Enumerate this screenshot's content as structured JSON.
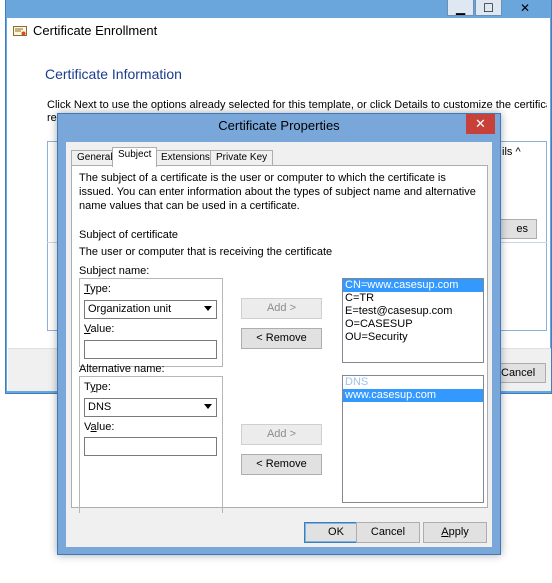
{
  "caption_buttons": {
    "minimize": "▁",
    "maximize": "☐",
    "close": "✕"
  },
  "wizard": {
    "title": "Certificate Enrollment",
    "heading": "Certificate Information",
    "instructions": "Click Next to use the options already selected for this template, or click Details to customize the certificate",
    "instructions_cont": "re",
    "details_link": "ils ^",
    "properties_button": "es",
    "cancel_button": "Cancel"
  },
  "dialog": {
    "title": "Certificate Properties",
    "close_glyph": "✕",
    "tabs": [
      {
        "label": "General"
      },
      {
        "label": "Subject"
      },
      {
        "label": "Extensions"
      },
      {
        "label": "Private Key"
      }
    ],
    "description": "The subject of a certificate is the user or computer to which the certificate is issued. You can enter information about the types of subject name and alternative name values that can be used in a certificate.",
    "subject_heading": "Subject of certificate",
    "subject_sub": "The user or computer that is receiving the certificate",
    "subject_name": {
      "group_label": "Subject name:",
      "type_label": "Type:",
      "type_value": "Organization unit",
      "value_label": "Value:",
      "value": "",
      "add_button": "Add >",
      "remove_button": "< Remove",
      "list": [
        {
          "text": "CN=www.casesup.com",
          "selected": true
        },
        {
          "text": "C=TR"
        },
        {
          "text": "E=test@casesup.com"
        },
        {
          "text": "O=CASESUP"
        },
        {
          "text": "OU=Security"
        }
      ]
    },
    "alt_name": {
      "group_label": "Alternative name:",
      "type_label": "Type:",
      "type_value": "DNS",
      "value_label": "Value:",
      "value": "",
      "add_button": "Add >",
      "remove_button": "< Remove",
      "list": [
        {
          "text": "DNS",
          "header": true
        },
        {
          "text": "www.casesup.com",
          "selected": true
        }
      ]
    },
    "buttons": {
      "ok": "OK",
      "cancel": "Cancel",
      "apply": "Apply"
    }
  }
}
